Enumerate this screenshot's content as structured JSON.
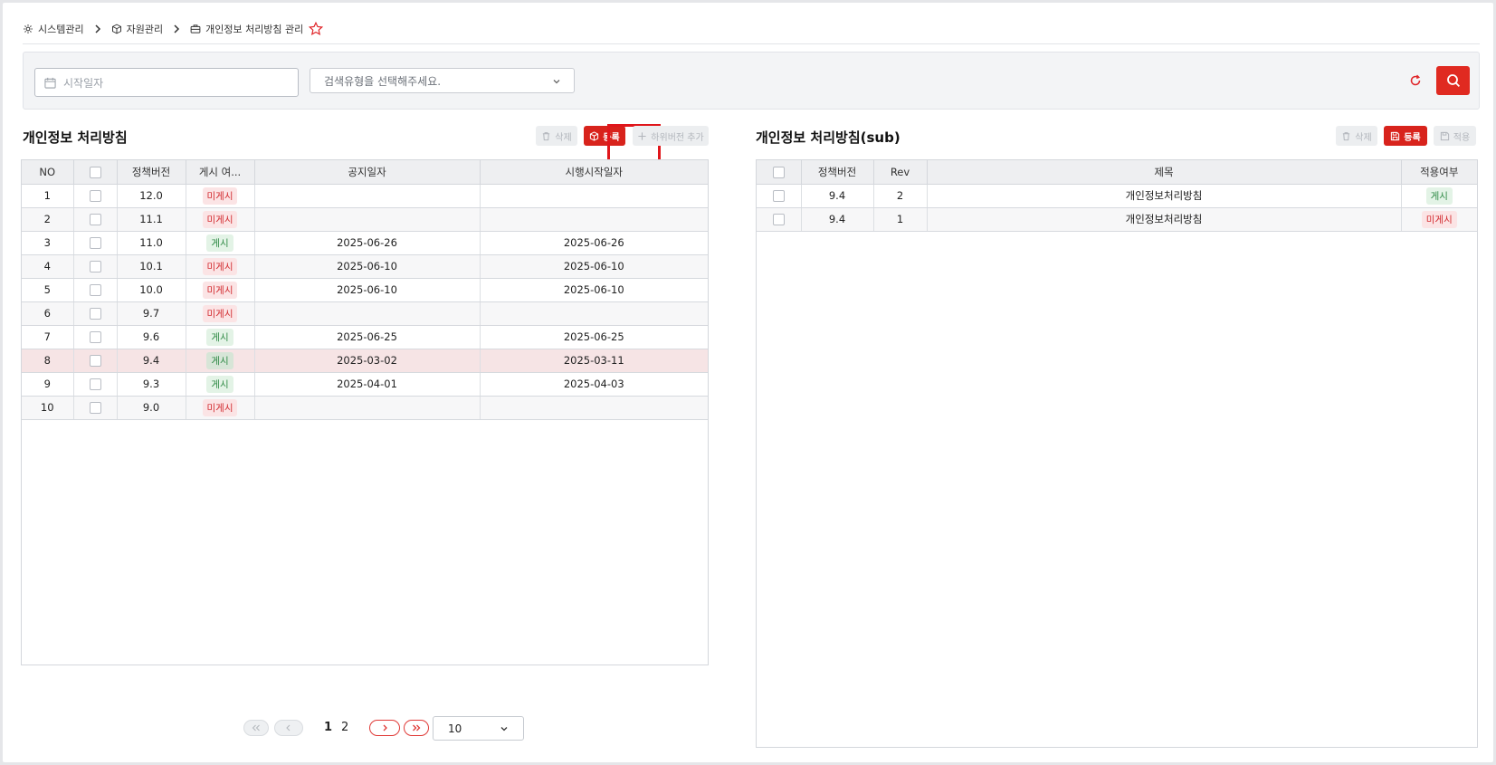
{
  "breadcrumb": {
    "items": [
      "시스템관리",
      "자원관리",
      "개인정보 처리방침 관리"
    ]
  },
  "search": {
    "date_placeholder": "시작일자",
    "type_placeholder": "검색유형을 선택해주세요."
  },
  "left": {
    "title": "개인정보 처리방침",
    "buttons": {
      "delete": "삭제",
      "register": "등록",
      "add_sub": "하위버전 추가"
    },
    "columns": [
      "NO",
      "",
      "정책버전",
      "게시 여...",
      "공지일자",
      "시행시작일자"
    ],
    "rows": [
      {
        "no": "1",
        "version": "12.0",
        "status": "미게시",
        "notice": "",
        "start": ""
      },
      {
        "no": "2",
        "version": "11.1",
        "status": "미게시",
        "notice": "",
        "start": ""
      },
      {
        "no": "3",
        "version": "11.0",
        "status": "게시",
        "notice": "2025-06-26",
        "start": "2025-06-26"
      },
      {
        "no": "4",
        "version": "10.1",
        "status": "미게시",
        "notice": "2025-06-10",
        "start": "2025-06-10"
      },
      {
        "no": "5",
        "version": "10.0",
        "status": "미게시",
        "notice": "2025-06-10",
        "start": "2025-06-10"
      },
      {
        "no": "6",
        "version": "9.7",
        "status": "미게시",
        "notice": "",
        "start": ""
      },
      {
        "no": "7",
        "version": "9.6",
        "status": "게시",
        "notice": "2025-06-25",
        "start": "2025-06-25"
      },
      {
        "no": "8",
        "version": "9.4",
        "status": "게시",
        "notice": "2025-03-02",
        "start": "2025-03-11"
      },
      {
        "no": "9",
        "version": "9.3",
        "status": "게시",
        "notice": "2025-04-01",
        "start": "2025-04-03"
      },
      {
        "no": "10",
        "version": "9.0",
        "status": "미게시",
        "notice": "",
        "start": ""
      }
    ],
    "pagination": {
      "pages": [
        "1",
        "2"
      ],
      "current": "1",
      "page_size": "10"
    }
  },
  "right": {
    "title": "개인정보 처리방침(sub)",
    "buttons": {
      "delete": "삭제",
      "register": "등록",
      "apply": "적용"
    },
    "columns": [
      "",
      "정책버전",
      "Rev",
      "제목",
      "적용여부"
    ],
    "rows": [
      {
        "version": "9.4",
        "rev": "2",
        "title": "개인정보처리방침",
        "status": "게시"
      },
      {
        "version": "9.4",
        "rev": "1",
        "title": "개인정보처리방침",
        "status": "미게시"
      }
    ]
  },
  "colors": {
    "accent": "#d8231c",
    "published": "#2f8a45",
    "unpublished": "#d22a2f"
  },
  "icons": [
    "gear-icon",
    "box-icon",
    "briefcase-icon",
    "star-icon",
    "calendar-icon",
    "chevron-down-icon",
    "refresh-icon",
    "search-icon",
    "trash-icon",
    "plus-icon",
    "save-icon"
  ]
}
